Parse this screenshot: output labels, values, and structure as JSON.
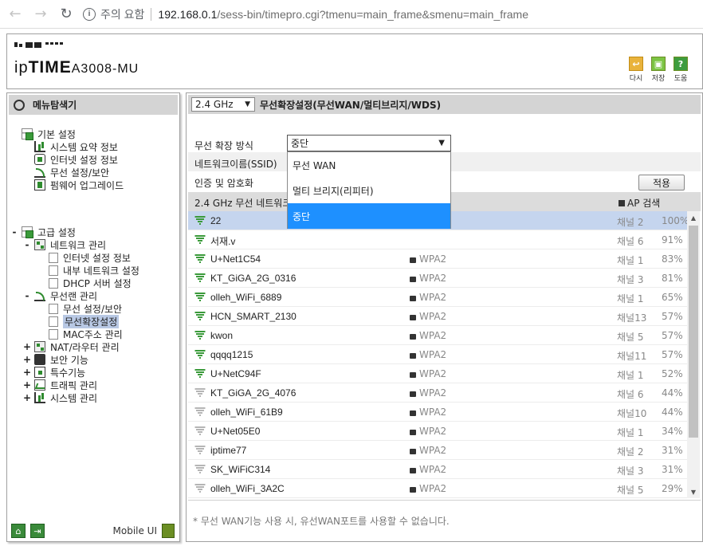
{
  "browser": {
    "back_icon": "←",
    "forward_icon": "→",
    "reload_icon": "↻",
    "security_label": "주의 요함",
    "url_host": "192.168.0.1",
    "url_path": "/sess-bin/timepro.cgi?tmenu=main_frame&smenu=main_frame"
  },
  "header": {
    "brand": "ipTIME",
    "brand_prefix": "ip",
    "brand_bold": "TIME",
    "model": "A3008-MU",
    "buttons": [
      {
        "label": "다시",
        "icon": "back-icon"
      },
      {
        "label": "저장",
        "icon": "save-icon"
      },
      {
        "label": "도움",
        "icon": "help-icon"
      }
    ]
  },
  "menu": {
    "title": "메뉴탐색기",
    "basic": {
      "label": "기본 설정",
      "items": [
        "시스템 요약 정보",
        "인터넷 설정 정보",
        "무선 설정/보안",
        "펌웨어 업그레이드"
      ]
    },
    "advanced": {
      "label": "고급 설정",
      "network": {
        "label": "네트워크 관리",
        "items": [
          "인터넷 설정 정보",
          "내부 네트워크 설정",
          "DHCP 서버 설정"
        ]
      },
      "wireless": {
        "label": "무선랜 관리",
        "items": [
          "무선 설정/보안",
          "무선확장설정",
          "MAC주소 관리"
        ]
      },
      "others": [
        "NAT/라우터 관리",
        "보안 기능",
        "특수기능",
        "트래픽 관리",
        "시스템 관리"
      ]
    },
    "footer": {
      "mobile_label": "Mobile UI"
    }
  },
  "content": {
    "band": "2.4 GHz",
    "title": "무선확장설정(무선WAN/멀티브리지/WDS)",
    "mode_label": "무선 확장 방식",
    "mode_value": "중단",
    "ssid_label": "네트워크이름(SSID)",
    "auth_label": "인증 및 암호화",
    "apply_label": "적용",
    "list_title": "2.4 GHz 무선 네트워크",
    "ap_scan_label": "AP 검색",
    "dropdown_options": [
      "무선 WAN",
      "멀티 브리지(리피터)",
      "중단"
    ],
    "ap_list": [
      {
        "ssid": "22",
        "security": "",
        "channel": "채널 2",
        "signal": "100%",
        "strong": true
      },
      {
        "ssid": "서재.v",
        "security": "",
        "channel": "채널 6",
        "signal": "91%",
        "strong": true
      },
      {
        "ssid": "U+Net1C54",
        "security": "WPA2",
        "channel": "채널 1",
        "signal": "83%",
        "strong": true
      },
      {
        "ssid": "KT_GiGA_2G_0316",
        "security": "WPA2",
        "channel": "채널 3",
        "signal": "81%",
        "strong": true
      },
      {
        "ssid": "olleh_WiFi_6889",
        "security": "WPA2",
        "channel": "채널 1",
        "signal": "65%",
        "strong": true
      },
      {
        "ssid": "HCN_SMART_2130",
        "security": "WPA2",
        "channel": "채널13",
        "signal": "57%",
        "strong": true
      },
      {
        "ssid": "kwon",
        "security": "WPA2",
        "channel": "채널 5",
        "signal": "57%",
        "strong": true
      },
      {
        "ssid": "qqqq1215",
        "security": "WPA2",
        "channel": "채널11",
        "signal": "57%",
        "strong": true
      },
      {
        "ssid": "U+NetC94F",
        "security": "WPA2",
        "channel": "채널 1",
        "signal": "52%",
        "strong": true
      },
      {
        "ssid": "KT_GiGA_2G_4076",
        "security": "WPA2",
        "channel": "채널 6",
        "signal": "44%",
        "strong": false
      },
      {
        "ssid": "olleh_WiFi_61B9",
        "security": "WPA2",
        "channel": "채널10",
        "signal": "44%",
        "strong": false
      },
      {
        "ssid": "U+Net05E0",
        "security": "WPA2",
        "channel": "채널 1",
        "signal": "34%",
        "strong": false
      },
      {
        "ssid": "iptime77",
        "security": "WPA2",
        "channel": "채널 2",
        "signal": "31%",
        "strong": false
      },
      {
        "ssid": "SK_WiFiC314",
        "security": "WPA2",
        "channel": "채널 3",
        "signal": "31%",
        "strong": false
      },
      {
        "ssid": "olleh_WiFi_3A2C",
        "security": "WPA2",
        "channel": "채널 5",
        "signal": "29%",
        "strong": false
      }
    ],
    "note": "* 무선 WAN기능 사용 시, 유선WAN포트를 사용할 수 없습니다."
  }
}
